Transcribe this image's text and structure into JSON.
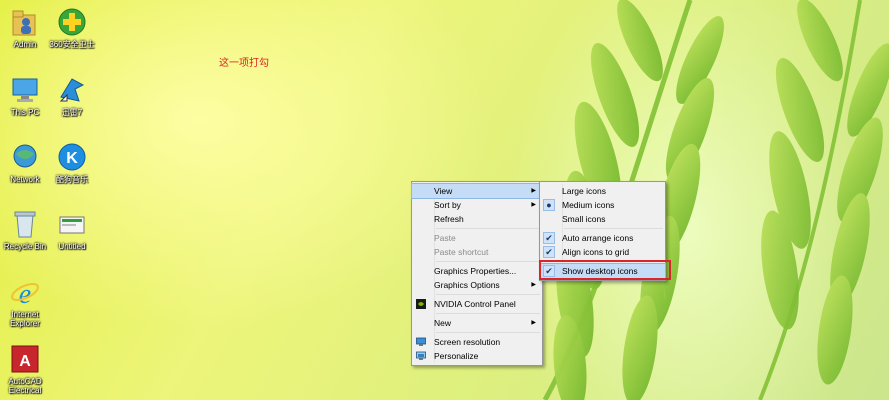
{
  "annotation": "这一项打勾",
  "desktop_icons": [
    {
      "name": "admin",
      "label": "Admin"
    },
    {
      "name": "360",
      "label": "360安全卫士"
    },
    {
      "name": "this-pc",
      "label": "This PC"
    },
    {
      "name": "app7",
      "label": "迅雷7"
    },
    {
      "name": "network",
      "label": "Network"
    },
    {
      "name": "kugou",
      "label": "酷狗音乐"
    },
    {
      "name": "recycle-bin",
      "label": "Recycle Bin"
    },
    {
      "name": "untitled",
      "label": "Untitled"
    },
    {
      "name": "ie",
      "label": "Internet Explorer"
    },
    {
      "name": "autocad",
      "label": "AutoCAD Electrical"
    }
  ],
  "context_menu": {
    "view": "View",
    "sort_by": "Sort by",
    "refresh": "Refresh",
    "paste": "Paste",
    "paste_shortcut": "Paste shortcut",
    "graphics_properties": "Graphics Properties...",
    "graphics_options": "Graphics Options",
    "nvidia": "NVIDIA Control Panel",
    "new": "New",
    "screen_resolution": "Screen resolution",
    "personalize": "Personalize"
  },
  "view_submenu": {
    "large_icons": "Large icons",
    "medium_icons": "Medium icons",
    "small_icons": "Small icons",
    "auto_arrange": "Auto arrange icons",
    "align_grid": "Align icons to grid",
    "show_desktop": "Show desktop icons"
  },
  "colors": {
    "highlight_box": "#d9262a",
    "annotation": "#e02020"
  }
}
